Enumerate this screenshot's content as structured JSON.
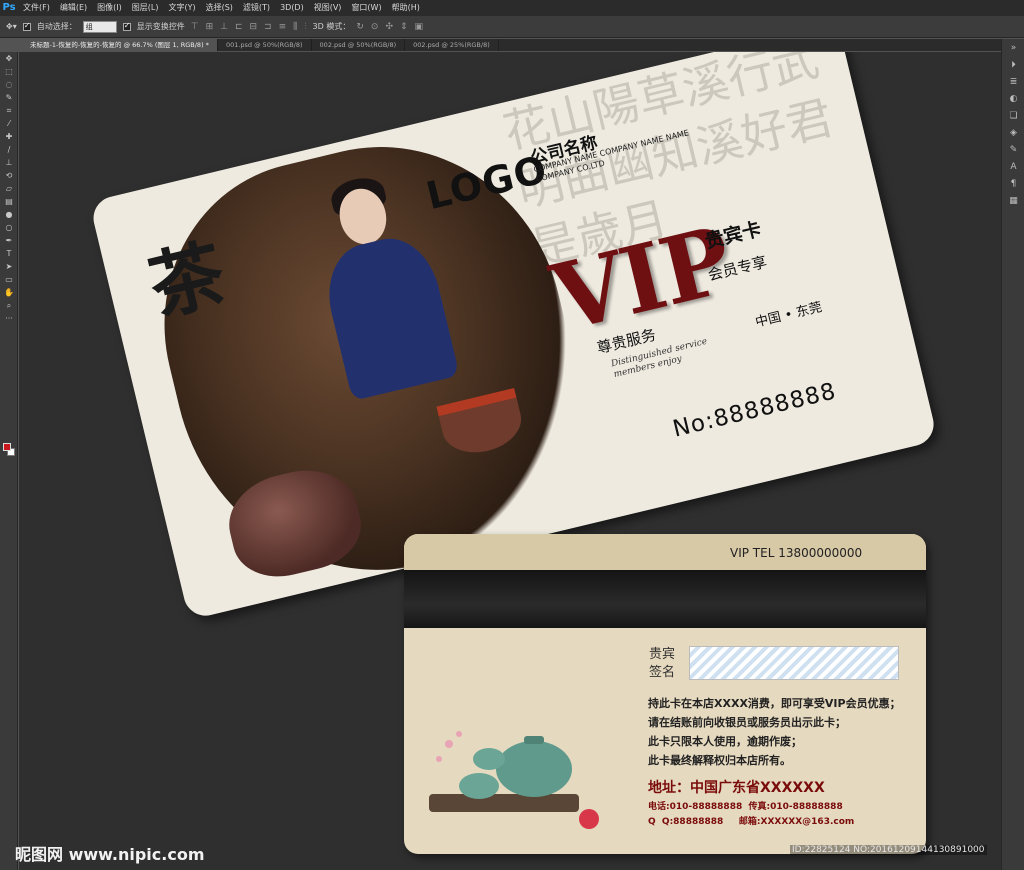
{
  "app": {
    "logo": "Ps",
    "menu": [
      "文件(F)",
      "编辑(E)",
      "图像(I)",
      "图层(L)",
      "文字(Y)",
      "选择(S)",
      "滤镜(T)",
      "3D(D)",
      "视图(V)",
      "窗口(W)",
      "帮助(H)"
    ]
  },
  "options_bar": {
    "auto_select_label": "自动选择：",
    "auto_select_value": "组",
    "transform_label": "显示变换控件",
    "mode_3d_label": "3D 模式："
  },
  "tabs": [
    "未标题-1-恢复的-恢复的-恢复的 @ 66.7% (图层 1, RGB/8) *",
    "001.psd @ 50%(RGB/8)",
    "002.psd @ 50%(RGB/8)",
    "002.psd @ 25%(RGB/8)"
  ],
  "colors": {
    "foreground": "#c7181d",
    "background": "#ffffff",
    "vip": "#6e0f12",
    "address": "#7a0b0b"
  },
  "front_card": {
    "tea_char": "茶",
    "logo": "LOGO",
    "company_name": "公司名称",
    "company_en": "COMPANY NAME COMPANY NAME NAME COMPANY CO.LTD",
    "vip": "VIP",
    "vip_sub": "贵宾卡",
    "tag_left": "尊贵服务",
    "tag_right": "会员专享",
    "distinguished": "Distinguished service members enjoy",
    "location": "中国 • 东莞",
    "card_no": "No:88888888",
    "calligraphy": "花山陽草溪行武明曲幽知溪好君是歲月"
  },
  "back_card": {
    "vip_tel": "VIP TEL 13800000000",
    "signature_label": "贵宾\n签名",
    "rules": [
      "持此卡在本店XXXX消费，即可享受VIP会员优惠；",
      "请在结账前向收银员或服务员出示此卡；",
      "此卡只限本人使用，逾期作废；",
      "此卡最终解释权归本店所有。"
    ],
    "address": "地址：中国广东省XXXXXX",
    "contact_line1": "电话:010-88888888  传真:010-88888888",
    "contact_line2": "Q  Q:88888888     邮箱:XXXXXX@163.com"
  },
  "watermark": {
    "left": "昵图网 www.nipic.com",
    "right": "ID:22825124 NO:20161209144130891000"
  }
}
